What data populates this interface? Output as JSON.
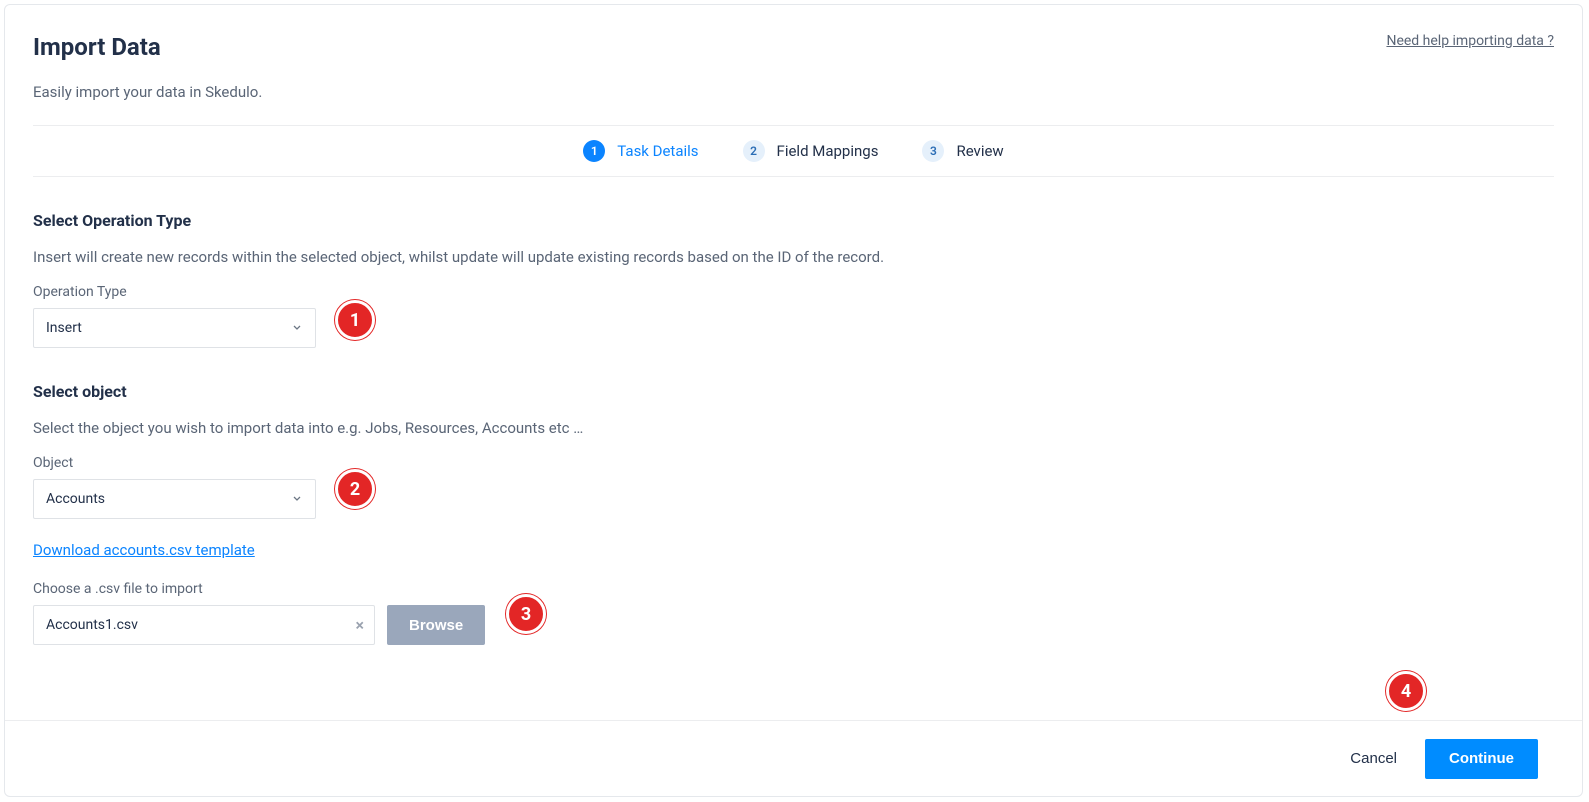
{
  "header": {
    "title": "Import Data",
    "help_link": "Need help importing data ?"
  },
  "subtitle": "Easily import your data in Skedulo.",
  "stepper": [
    {
      "num": "1",
      "label": "Task Details",
      "state": "active"
    },
    {
      "num": "2",
      "label": "Field Mappings",
      "state": "inactive"
    },
    {
      "num": "3",
      "label": "Review",
      "state": "inactive"
    }
  ],
  "operation_section": {
    "title": "Select Operation Type",
    "desc": "Insert will create new records within the selected object, whilst update will update existing records based on the ID of the record.",
    "field_label": "Operation Type",
    "value": "Insert"
  },
  "object_section": {
    "title": "Select object",
    "desc": "Select the object you wish to import data into e.g. Jobs, Resources, Accounts etc …",
    "field_label": "Object",
    "value": "Accounts",
    "download_link": "Download accounts.csv template"
  },
  "file_section": {
    "label": "Choose a .csv file to import",
    "file_name": "Accounts1.csv",
    "browse_label": "Browse"
  },
  "footer": {
    "cancel": "Cancel",
    "continue": "Continue"
  },
  "badges": {
    "b1": "1",
    "b2": "2",
    "b3": "3",
    "b4": "4"
  }
}
